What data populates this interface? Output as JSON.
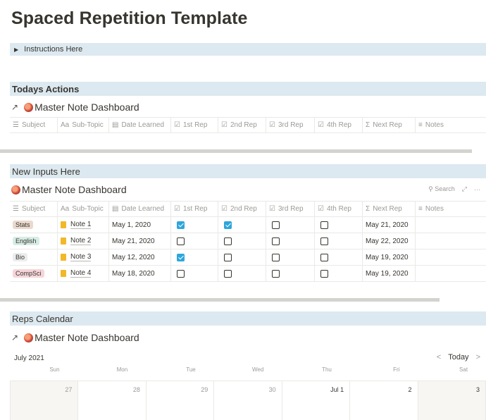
{
  "page": {
    "title": "Spaced Repetition Template"
  },
  "toggle": {
    "label": "Instructions Here"
  },
  "todays": {
    "header": "Todays Actions",
    "db_title": "Master Note Dashboard"
  },
  "columns": [
    {
      "label": "Subject",
      "icon": "☰"
    },
    {
      "label": "Sub-Topic",
      "icon": "Aa"
    },
    {
      "label": "Date Learned",
      "icon": "▤"
    },
    {
      "label": "1st Rep",
      "icon": "☑"
    },
    {
      "label": "2nd Rep",
      "icon": "☑"
    },
    {
      "label": "3rd Rep",
      "icon": "☑"
    },
    {
      "label": "4th Rep",
      "icon": "☑"
    },
    {
      "label": "Next Rep",
      "icon": "Σ"
    },
    {
      "label": "Notes",
      "icon": "≡"
    }
  ],
  "inputs": {
    "header": "New Inputs Here",
    "db_title": "Master Note Dashboard",
    "search_label": "Search",
    "expand_icon": "⤢",
    "more_icon": "···",
    "rows": [
      {
        "subject": "Stats",
        "subject_bg": "#ead9cd",
        "subtopic": "Note 1",
        "date": "May 1, 2020",
        "r1": true,
        "r2": true,
        "r3": false,
        "r4": false,
        "next": "May 21, 2020",
        "notes": ""
      },
      {
        "subject": "English",
        "subject_bg": "#d7ece5",
        "subtopic": "Note 2",
        "date": "May 21, 2020",
        "r1": false,
        "r2": false,
        "r3": false,
        "r4": false,
        "next": "May 22, 2020",
        "notes": ""
      },
      {
        "subject": "Bio",
        "subject_bg": "#ebeced",
        "subtopic": "Note 3",
        "date": "May 12, 2020",
        "r1": true,
        "r2": false,
        "r3": false,
        "r4": false,
        "next": "May 19, 2020",
        "notes": ""
      },
      {
        "subject": "CompSci",
        "subject_bg": "#f6d5d9",
        "subtopic": "Note 4",
        "date": "May 18, 2020",
        "r1": false,
        "r2": false,
        "r3": false,
        "r4": false,
        "next": "May 19, 2020",
        "notes": ""
      }
    ]
  },
  "calendar": {
    "header": "Reps Calendar",
    "db_title": "Master Note Dashboard",
    "month": "July 2021",
    "today_label": "Today",
    "days_of_week": [
      "Sun",
      "Mon",
      "Tue",
      "Wed",
      "Thu",
      "Fri",
      "Sat"
    ],
    "dates": [
      "27",
      "28",
      "29",
      "30",
      "Jul 1",
      "2",
      "3"
    ]
  },
  "colors": {
    "section_bg": "#dde9f0",
    "checkbox_on": "#2ea6dc",
    "divider": "#d3d3cf"
  }
}
